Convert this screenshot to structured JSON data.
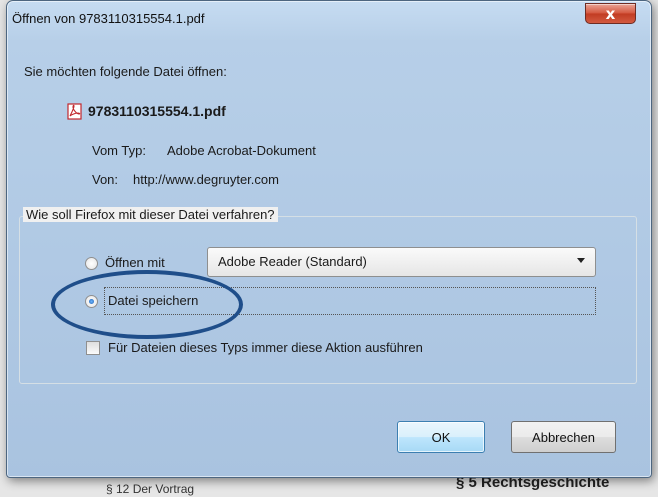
{
  "window": {
    "title": "Öffnen von 9783110315554.1.pdf",
    "close_label": "x"
  },
  "dialog": {
    "prompt": "Sie möchten folgende Datei öffnen:",
    "file": {
      "name": "9783110315554.1.pdf",
      "icon": "pdf-icon",
      "type_label": "Vom Typ:",
      "type_value": "Adobe Acrobat-Dokument",
      "from_label": "Von:",
      "from_value": "http://www.degruyter.com"
    },
    "group_title": "Wie soll Firefox mit dieser Datei verfahren?",
    "option_open": {
      "label": "Öffnen mit",
      "selected": false,
      "app": "Adobe Reader  (Standard)"
    },
    "option_save": {
      "label": "Datei speichern",
      "selected": true
    },
    "remember": {
      "label": "Für Dateien dieses Typs immer diese Aktion ausführen",
      "checked": false
    },
    "buttons": {
      "ok": "OK",
      "cancel": "Abbrechen"
    }
  },
  "background": {
    "left_text": "§ 12 Der Vortrag",
    "right_text": "§ 5 Rechtsgeschichte"
  },
  "colors": {
    "highlight_ellipse": "#1f4e8a",
    "close_button": "#c13b22",
    "ok_border": "#3c7fb1"
  }
}
